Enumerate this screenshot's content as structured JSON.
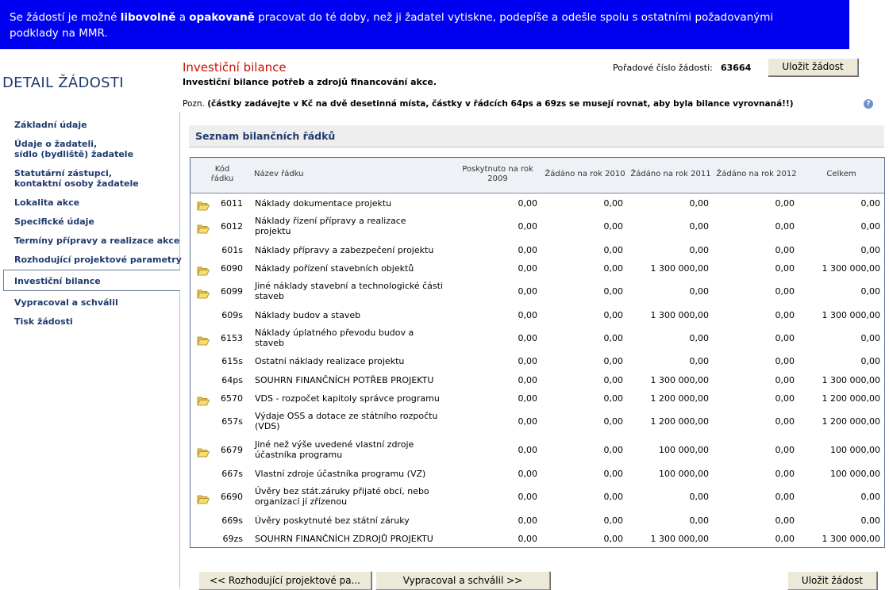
{
  "banner": {
    "t1": "Se žádostí je možné ",
    "b1": "libovolně",
    "t2": " a ",
    "b2": "opakovaně",
    "t3": " pracovat do té doby, než ji žadatel vytiskne, podepíše a odešle spolu s ostatními požadovanými",
    "line2": "podklady na MMR."
  },
  "sidebar": {
    "title": "DETAIL ŽÁDOSTI",
    "items": [
      {
        "label": "Základní údaje"
      },
      {
        "label": "Údaje o žadateli,",
        "label2": "sídlo (bydliště) žadatele"
      },
      {
        "label": "Statutární zástupci,",
        "label2": "kontaktní osoby žadatele"
      },
      {
        "label": "Lokalita akce"
      },
      {
        "label": "Specifické údaje"
      },
      {
        "label": "Termíny přípravy a realizace akce"
      },
      {
        "label": "Rozhodující projektové parametry"
      },
      {
        "label": "Investiční bilance"
      },
      {
        "label": "Vypracoval a schválil"
      },
      {
        "label": "Tisk žádosti"
      }
    ]
  },
  "header": {
    "title": "Investiční bilance",
    "subtitle": "Investiční bilance potřeb a zdrojů financování akce.",
    "poradove_label": "Pořadové číslo žádosti:",
    "poradove_value": "63664",
    "save_label": "Uložit žádost",
    "pozn_label": "Pozn.",
    "pozn_text": "(částky zadávejte v Kč na dvě desetinná místa, částky v řádcích 64ps a 69zs se musejí rovnat, aby byla bilance vyrovnaná!!)",
    "help_glyph": "?"
  },
  "section": {
    "title": "Seznam bilančních řádků"
  },
  "table": {
    "headers": {
      "kod1": "Kód",
      "kod2": "řádku",
      "nazev": "Název řádku",
      "y2009a": "Poskytnuto na rok",
      "y2009b": "2009",
      "y2010": "Žádáno na rok 2010",
      "y2011": "Žádáno na rok 2011",
      "y2012": "Žádáno na rok 2012",
      "celkem": "Celkem"
    },
    "rows": [
      {
        "folder": true,
        "kod": "6011",
        "nazev": "Náklady dokumentace projektu",
        "nazev2": "",
        "v2009": "0,00",
        "v2010": "0,00",
        "v2011": "0,00",
        "v2012": "0,00",
        "celkem": "0,00"
      },
      {
        "folder": true,
        "kod": "6012",
        "nazev": "Náklady řízení přípravy a realizace",
        "nazev2": "projektu",
        "v2009": "0,00",
        "v2010": "0,00",
        "v2011": "0,00",
        "v2012": "0,00",
        "celkem": "0,00"
      },
      {
        "folder": false,
        "kod": "601s",
        "nazev": "Náklady přípravy a zabezpečení projektu",
        "nazev2": "",
        "v2009": "0,00",
        "v2010": "0,00",
        "v2011": "0,00",
        "v2012": "0,00",
        "celkem": "0,00"
      },
      {
        "folder": true,
        "kod": "6090",
        "nazev": "Náklady pořízení stavebních objektů",
        "nazev2": "",
        "v2009": "0,00",
        "v2010": "0,00",
        "v2011": "1 300 000,00",
        "v2012": "0,00",
        "celkem": "1 300 000,00"
      },
      {
        "folder": true,
        "kod": "6099",
        "nazev": "Jiné náklady stavební a technologické části",
        "nazev2": "staveb",
        "v2009": "0,00",
        "v2010": "0,00",
        "v2011": "0,00",
        "v2012": "0,00",
        "celkem": "0,00"
      },
      {
        "folder": false,
        "kod": "609s",
        "nazev": "Náklady budov a staveb",
        "nazev2": "",
        "v2009": "0,00",
        "v2010": "0,00",
        "v2011": "1 300 000,00",
        "v2012": "0,00",
        "celkem": "1 300 000,00"
      },
      {
        "folder": true,
        "kod": "6153",
        "nazev": "Náklady úplatného převodu budov a",
        "nazev2": "staveb",
        "v2009": "0,00",
        "v2010": "0,00",
        "v2011": "0,00",
        "v2012": "0,00",
        "celkem": "0,00"
      },
      {
        "folder": false,
        "kod": "615s",
        "nazev": "Ostatní náklady realizace projektu",
        "nazev2": "",
        "v2009": "0,00",
        "v2010": "0,00",
        "v2011": "0,00",
        "v2012": "0,00",
        "celkem": "0,00"
      },
      {
        "folder": false,
        "kod": "64ps",
        "nazev": "SOUHRN FINANČNÍCH POTŘEB PROJEKTU",
        "nazev2": "",
        "v2009": "0,00",
        "v2010": "0,00",
        "v2011": "1 300 000,00",
        "v2012": "0,00",
        "celkem": "1 300 000,00"
      },
      {
        "folder": true,
        "kod": "6570",
        "nazev": "VDS - rozpočet kapitoly správce programu",
        "nazev2": "",
        "v2009": "0,00",
        "v2010": "0,00",
        "v2011": "1 200 000,00",
        "v2012": "0,00",
        "celkem": "1 200 000,00"
      },
      {
        "folder": false,
        "kod": "657s",
        "nazev": "Výdaje OSS a dotace ze státního rozpočtu",
        "nazev2": "(VDS)",
        "v2009": "0,00",
        "v2010": "0,00",
        "v2011": "1 200 000,00",
        "v2012": "0,00",
        "celkem": "1 200 000,00"
      },
      {
        "folder": true,
        "kod": "6679",
        "nazev": "Jiné než výše uvedené vlastní zdroje",
        "nazev2": "účastníka programu",
        "v2009": "0,00",
        "v2010": "0,00",
        "v2011": "100 000,00",
        "v2012": "0,00",
        "celkem": "100 000,00"
      },
      {
        "folder": false,
        "kod": "667s",
        "nazev": "Vlastní zdroje účastníka programu (VZ)",
        "nazev2": "",
        "v2009": "0,00",
        "v2010": "0,00",
        "v2011": "100 000,00",
        "v2012": "0,00",
        "celkem": "100 000,00"
      },
      {
        "folder": true,
        "kod": "6690",
        "nazev": "Úvěry bez stát.záruky přijaté obcí, nebo",
        "nazev2": "organizací jí zřízenou",
        "v2009": "0,00",
        "v2010": "0,00",
        "v2011": "0,00",
        "v2012": "0,00",
        "celkem": "0,00"
      },
      {
        "folder": false,
        "kod": "669s",
        "nazev": "Úvěry poskytnuté bez státní záruky",
        "nazev2": "",
        "v2009": "0,00",
        "v2010": "0,00",
        "v2011": "0,00",
        "v2012": "0,00",
        "celkem": "0,00"
      },
      {
        "folder": false,
        "kod": "69zs",
        "nazev": "SOUHRN FINANČNÍCH ZDROJŮ PROJEKTU",
        "nazev2": "",
        "v2009": "0,00",
        "v2010": "0,00",
        "v2011": "1 300 000,00",
        "v2012": "0,00",
        "celkem": "1 300 000,00"
      }
    ]
  },
  "footer": {
    "prev_label": "<<  Rozhodující projektové pa...",
    "next_label": "Vypracoval a schválil  >>",
    "save_label": "Uložit žádost"
  },
  "colors": {
    "banner": "#0000f0",
    "title_red": "#cc1100",
    "nav_blue": "#1f3a6e",
    "button_face": "#ece9d8"
  },
  "icons": {
    "folder": "folder-open-icon",
    "help": "help-icon"
  }
}
